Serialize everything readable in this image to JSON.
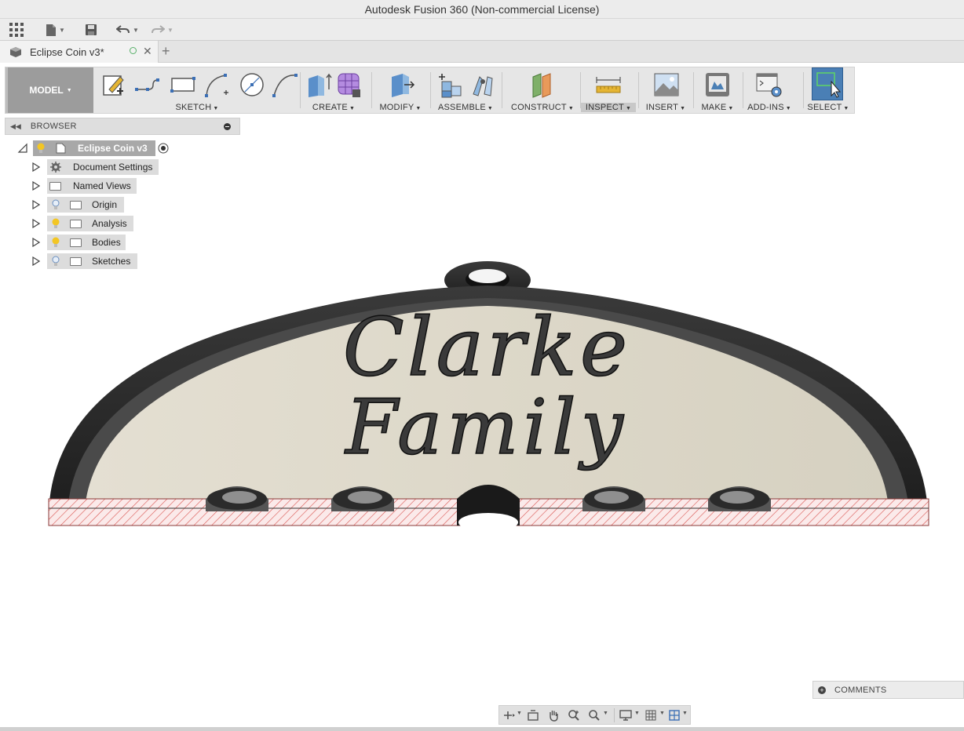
{
  "window": {
    "title": "Autodesk Fusion 360 (Non-commercial License)"
  },
  "quick_access": {
    "items": [
      "apps-grid-icon",
      "file-icon",
      "save-icon",
      "undo-icon",
      "redo-icon"
    ]
  },
  "document_tab": {
    "title": "Eclipse Coin v3*",
    "new_tab": "+"
  },
  "ribbon": {
    "workspace": "MODEL",
    "groups": [
      {
        "id": "sketch",
        "label": "SKETCH"
      },
      {
        "id": "create",
        "label": "CREATE"
      },
      {
        "id": "modify",
        "label": "MODIFY"
      },
      {
        "id": "assemble",
        "label": "ASSEMBLE"
      },
      {
        "id": "construct",
        "label": "CONSTRUCT"
      },
      {
        "id": "inspect",
        "label": "INSPECT",
        "active": true
      },
      {
        "id": "insert",
        "label": "INSERT"
      },
      {
        "id": "make",
        "label": "MAKE"
      },
      {
        "id": "addins",
        "label": "ADD-INS"
      },
      {
        "id": "select",
        "label": "SELECT"
      }
    ]
  },
  "browser": {
    "title": "BROWSER",
    "root": "Eclipse Coin v3",
    "items": [
      {
        "label": "Document Settings",
        "icon": "gear-icon"
      },
      {
        "label": "Named Views",
        "icon": "folder-icon"
      },
      {
        "label": "Origin",
        "icon": "folder-icon",
        "bulb": "off"
      },
      {
        "label": "Analysis",
        "icon": "folder-icon",
        "bulb": "on"
      },
      {
        "label": "Bodies",
        "icon": "folder-icon",
        "bulb": "on"
      },
      {
        "label": "Sketches",
        "icon": "folder-icon",
        "bulb": "off"
      }
    ]
  },
  "model": {
    "engraving_line1": "Clarke",
    "engraving_line2": "Family",
    "face_color": "#ddd8c9",
    "rim_color": "#2e2e2e",
    "section_hatch_color": "#d9534f"
  },
  "comments": {
    "title": "COMMENTS"
  },
  "colors": {
    "accent": "#4a7fb5",
    "ribbon_bg": "#e6e6e6",
    "model_btn": "#9c9c9c"
  }
}
